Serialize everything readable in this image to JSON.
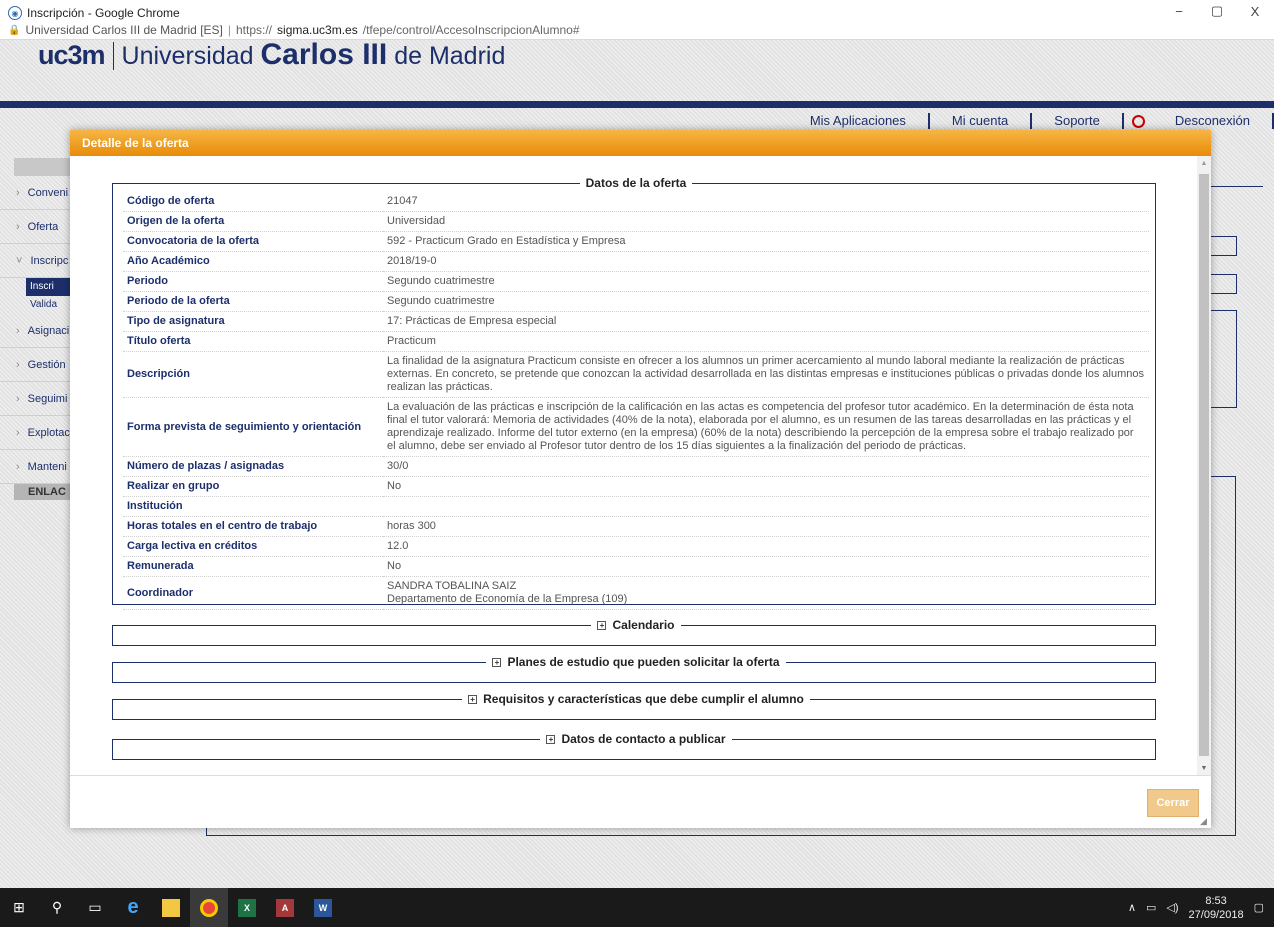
{
  "window": {
    "title": "Inscripción - Google Chrome",
    "controls": {
      "minimize": "−",
      "maximize": "▢",
      "close": "X"
    }
  },
  "addressbar": {
    "site_label": "Universidad Carlos III de Madrid [ES]",
    "separator": "|",
    "url_scheme": "https://",
    "url_host": "sigma.uc3m.es",
    "url_path": "/tfepe/control/AccesoInscripcionAlumno#"
  },
  "brand": {
    "logo": "uc3m",
    "name_prefix": "Universidad",
    "name_bold": "Carlos III",
    "name_suffix": "de Madrid"
  },
  "topnav": {
    "items": [
      "Mis Aplicaciones",
      "Mi cuenta",
      "Soporte"
    ],
    "logout": "Desconexión"
  },
  "sidebar": {
    "items": [
      {
        "label": "Conveni"
      },
      {
        "label": "Oferta"
      },
      {
        "label": "Inscripc"
      },
      {
        "label": "Asignaci"
      },
      {
        "label": "Gestión"
      },
      {
        "label": "Seguimi"
      },
      {
        "label": "Explotac"
      },
      {
        "label": "Manteni"
      }
    ],
    "subitems": [
      "Inscri",
      "Valida"
    ],
    "enlaces": "ENLAC"
  },
  "modal": {
    "title": "Detalle de la oferta",
    "section_main": "Datos de la oferta",
    "rows": [
      {
        "label": "Código de oferta",
        "value": "21047"
      },
      {
        "label": "Origen de la oferta",
        "value": "Universidad"
      },
      {
        "label": "Convocatoria de la oferta",
        "value": "592 - Practicum Grado en Estadística y Empresa"
      },
      {
        "label": "Año Académico",
        "value": "2018/19-0"
      },
      {
        "label": "Periodo",
        "value": "Segundo cuatrimestre"
      },
      {
        "label": "Periodo de la oferta",
        "value": "Segundo cuatrimestre"
      },
      {
        "label": "Tipo de asignatura",
        "value": "17: Prácticas de Empresa especial"
      },
      {
        "label": "Título oferta",
        "value": "Practicum"
      },
      {
        "label": "Descripción",
        "value": "La finalidad de la asignatura Practicum consiste en ofrecer a los alumnos un primer acercamiento al mundo laboral mediante la realización de prácticas externas. En concreto, se pretende que conozcan la actividad desarrollada en las distintas empresas e instituciones públicas o privadas donde los alumnos realizan las prácticas."
      },
      {
        "label": "Forma prevista de seguimiento y orientación",
        "value": "La evaluación de las prácticas e inscripción de la calificación en las actas es competencia del profesor tutor académico. En la determinación de ésta nota final el tutor valorará: Memoria de actividades (40% de la nota), elaborada por el alumno, es un resumen de las tareas desarrolladas en las prácticas y el aprendizaje realizado. Informe del tutor externo (en la empresa) (60% de la nota) describiendo la percepción de la empresa sobre el trabajo realizado por el alumno, debe ser enviado al Profesor tutor dentro de los 15 días siguientes a la finalización del periodo de prácticas."
      },
      {
        "label": "Número de plazas / asignadas",
        "value": "30/0"
      },
      {
        "label": "Realizar en grupo",
        "value": "No"
      },
      {
        "label": "Institución",
        "value": ""
      },
      {
        "label": "Horas totales en el centro de trabajo",
        "value": "horas 300"
      },
      {
        "label": "Carga lectiva en créditos",
        "value": "12.0"
      },
      {
        "label": "Remunerada",
        "value": "No"
      },
      {
        "label": "Coordinador",
        "value": "SANDRA TOBALINA SAIZ",
        "value2": "Departamento de Economía de la Empresa (109)"
      }
    ],
    "collapsed_sections": [
      "Calendario",
      "Planes de estudio que pueden solicitar la oferta",
      "Requisitos y características que debe cumplir el alumno",
      "Datos de contacto a publicar"
    ],
    "expand_glyph": "+",
    "close_button": "Cerrar"
  },
  "taskbar": {
    "time": "8:53",
    "date": "27/09/2018"
  },
  "colors": {
    "accent_orange": "#e88c08",
    "brand_navy": "#1c2f6b",
    "label_navy": "#1c2f6b"
  }
}
